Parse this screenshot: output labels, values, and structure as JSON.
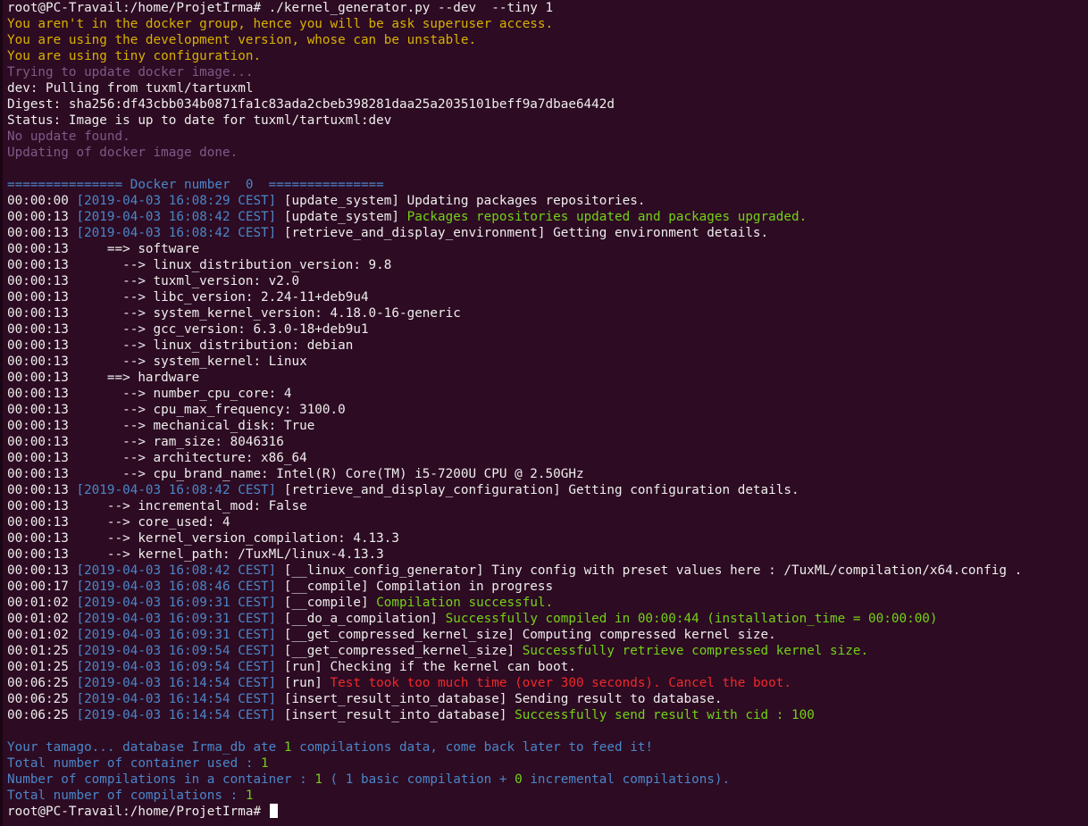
{
  "colors": {
    "background": "#2d0b23",
    "white": "#ffffff",
    "yellow": "#c4a000",
    "purple": "#75507b",
    "blue": "#3465a4",
    "green": "#4e9a06",
    "red": "#cc0000"
  },
  "cursor": "block-cursor",
  "lines": [
    [
      {
        "t": "root@PC-Travail:/home/ProjetIrma# ./kernel_generator.py --dev  --tiny 1",
        "c": "white"
      }
    ],
    [
      {
        "t": "You aren't in the docker group, hence you will be ask superuser access.",
        "c": "yellow"
      }
    ],
    [
      {
        "t": "You are using the development version, whose can be unstable.",
        "c": "yellow"
      }
    ],
    [
      {
        "t": "You are using tiny configuration.",
        "c": "yellow"
      }
    ],
    [
      {
        "t": "Trying to update docker image...",
        "c": "purple"
      }
    ],
    [
      {
        "t": "dev: Pulling from tuxml/tartuxml",
        "c": "white"
      }
    ],
    [
      {
        "t": "Digest: sha256:df43cbb034b0871fa1c83ada2cbeb398281daa25a2035101beff9a7dbae6442d",
        "c": "white"
      }
    ],
    [
      {
        "t": "Status: Image is up to date for tuxml/tartuxml:dev",
        "c": "white"
      }
    ],
    [
      {
        "t": "No update found.",
        "c": "purple"
      }
    ],
    [
      {
        "t": "Updating of docker image done.",
        "c": "purple"
      }
    ],
    [
      {
        "t": "",
        "c": "white"
      }
    ],
    [
      {
        "t": "=============== Docker number  0  ===============",
        "c": "blue"
      }
    ],
    [
      {
        "t": "00:00:00 ",
        "c": "white"
      },
      {
        "t": "[2019-04-03 16:08:29 CEST]",
        "c": "blue"
      },
      {
        "t": " [update_system] Updating packages repositories.",
        "c": "white"
      }
    ],
    [
      {
        "t": "00:00:13 ",
        "c": "white"
      },
      {
        "t": "[2019-04-03 16:08:42 CEST]",
        "c": "blue"
      },
      {
        "t": " [update_system] ",
        "c": "white"
      },
      {
        "t": "Packages repositories updated and packages upgraded.",
        "c": "green"
      }
    ],
    [
      {
        "t": "00:00:13 ",
        "c": "white"
      },
      {
        "t": "[2019-04-03 16:08:42 CEST]",
        "c": "blue"
      },
      {
        "t": " [retrieve_and_display_environment] Getting environment details.",
        "c": "white"
      }
    ],
    [
      {
        "t": "00:00:13     ==> software",
        "c": "white"
      }
    ],
    [
      {
        "t": "00:00:13       --> linux_distribution_version: 9.8",
        "c": "white"
      }
    ],
    [
      {
        "t": "00:00:13       --> tuxml_version: v2.0",
        "c": "white"
      }
    ],
    [
      {
        "t": "00:00:13       --> libc_version: 2.24-11+deb9u4",
        "c": "white"
      }
    ],
    [
      {
        "t": "00:00:13       --> system_kernel_version: 4.18.0-16-generic",
        "c": "white"
      }
    ],
    [
      {
        "t": "00:00:13       --> gcc_version: 6.3.0-18+deb9u1",
        "c": "white"
      }
    ],
    [
      {
        "t": "00:00:13       --> linux_distribution: debian",
        "c": "white"
      }
    ],
    [
      {
        "t": "00:00:13       --> system_kernel: Linux",
        "c": "white"
      }
    ],
    [
      {
        "t": "00:00:13     ==> hardware",
        "c": "white"
      }
    ],
    [
      {
        "t": "00:00:13       --> number_cpu_core: 4",
        "c": "white"
      }
    ],
    [
      {
        "t": "00:00:13       --> cpu_max_frequency: 3100.0",
        "c": "white"
      }
    ],
    [
      {
        "t": "00:00:13       --> mechanical_disk: True",
        "c": "white"
      }
    ],
    [
      {
        "t": "00:00:13       --> ram_size: 8046316",
        "c": "white"
      }
    ],
    [
      {
        "t": "00:00:13       --> architecture: x86_64",
        "c": "white"
      }
    ],
    [
      {
        "t": "00:00:13       --> cpu_brand_name: Intel(R) Core(TM) i5-7200U CPU @ 2.50GHz",
        "c": "white"
      }
    ],
    [
      {
        "t": "00:00:13 ",
        "c": "white"
      },
      {
        "t": "[2019-04-03 16:08:42 CEST]",
        "c": "blue"
      },
      {
        "t": " [retrieve_and_display_configuration] Getting configuration details.",
        "c": "white"
      }
    ],
    [
      {
        "t": "00:00:13     --> incremental_mod: False",
        "c": "white"
      }
    ],
    [
      {
        "t": "00:00:13     --> core_used: 4",
        "c": "white"
      }
    ],
    [
      {
        "t": "00:00:13     --> kernel_version_compilation: 4.13.3",
        "c": "white"
      }
    ],
    [
      {
        "t": "00:00:13     --> kernel_path: /TuxML/linux-4.13.3",
        "c": "white"
      }
    ],
    [
      {
        "t": "00:00:13 ",
        "c": "white"
      },
      {
        "t": "[2019-04-03 16:08:42 CEST]",
        "c": "blue"
      },
      {
        "t": " [__linux_config_generator] Tiny config with preset values here : /TuxML/compilation/x64.config .",
        "c": "white"
      }
    ],
    [
      {
        "t": "00:00:17 ",
        "c": "white"
      },
      {
        "t": "[2019-04-03 16:08:46 CEST]",
        "c": "blue"
      },
      {
        "t": " [__compile] Compilation in progress",
        "c": "white"
      }
    ],
    [
      {
        "t": "00:01:02 ",
        "c": "white"
      },
      {
        "t": "[2019-04-03 16:09:31 CEST]",
        "c": "blue"
      },
      {
        "t": " [__compile] ",
        "c": "white"
      },
      {
        "t": "Compilation successful.",
        "c": "green"
      }
    ],
    [
      {
        "t": "00:01:02 ",
        "c": "white"
      },
      {
        "t": "[2019-04-03 16:09:31 CEST]",
        "c": "blue"
      },
      {
        "t": " [__do_a_compilation] ",
        "c": "white"
      },
      {
        "t": "Successfully compiled in 00:00:44 (installation_time = 00:00:00)",
        "c": "green"
      }
    ],
    [
      {
        "t": "00:01:02 ",
        "c": "white"
      },
      {
        "t": "[2019-04-03 16:09:31 CEST]",
        "c": "blue"
      },
      {
        "t": " [__get_compressed_kernel_size] Computing compressed kernel size.",
        "c": "white"
      }
    ],
    [
      {
        "t": "00:01:25 ",
        "c": "white"
      },
      {
        "t": "[2019-04-03 16:09:54 CEST]",
        "c": "blue"
      },
      {
        "t": " [__get_compressed_kernel_size] ",
        "c": "white"
      },
      {
        "t": "Successfully retrieve compressed kernel size.",
        "c": "green"
      }
    ],
    [
      {
        "t": "00:01:25 ",
        "c": "white"
      },
      {
        "t": "[2019-04-03 16:09:54 CEST]",
        "c": "blue"
      },
      {
        "t": " [run] Checking if the kernel can boot.",
        "c": "white"
      }
    ],
    [
      {
        "t": "00:06:25 ",
        "c": "white"
      },
      {
        "t": "[2019-04-03 16:14:54 CEST]",
        "c": "blue"
      },
      {
        "t": " [run] ",
        "c": "white"
      },
      {
        "t": "Test took too much time (over 300 seconds). Cancel the boot.",
        "c": "red"
      }
    ],
    [
      {
        "t": "00:06:25 ",
        "c": "white"
      },
      {
        "t": "[2019-04-03 16:14:54 CEST]",
        "c": "blue"
      },
      {
        "t": " [insert_result_into_database] Sending result to database.",
        "c": "white"
      }
    ],
    [
      {
        "t": "00:06:25 ",
        "c": "white"
      },
      {
        "t": "[2019-04-03 16:14:54 CEST]",
        "c": "blue"
      },
      {
        "t": " [insert_result_into_database] ",
        "c": "white"
      },
      {
        "t": "Successfully send result with cid : 100",
        "c": "green"
      }
    ],
    [
      {
        "t": "",
        "c": "white"
      }
    ],
    [
      {
        "t": "Your tamago... database Irma_db ate ",
        "c": "blue"
      },
      {
        "t": "1",
        "c": "green"
      },
      {
        "t": " compilations data, come back later to feed it!",
        "c": "blue"
      }
    ],
    [
      {
        "t": "Total number of container used : ",
        "c": "blue"
      },
      {
        "t": "1",
        "c": "green"
      }
    ],
    [
      {
        "t": "Number of compilations in a container : ",
        "c": "blue"
      },
      {
        "t": "1",
        "c": "green"
      },
      {
        "t": " ( 1 basic compilation + ",
        "c": "blue"
      },
      {
        "t": "0",
        "c": "green"
      },
      {
        "t": " incremental compilations).",
        "c": "blue"
      }
    ],
    [
      {
        "t": "Total number of compilations : ",
        "c": "blue"
      },
      {
        "t": "1",
        "c": "green"
      }
    ],
    [
      {
        "t": "root@PC-Travail:/home/ProjetIrma# ",
        "c": "white"
      }
    ]
  ]
}
